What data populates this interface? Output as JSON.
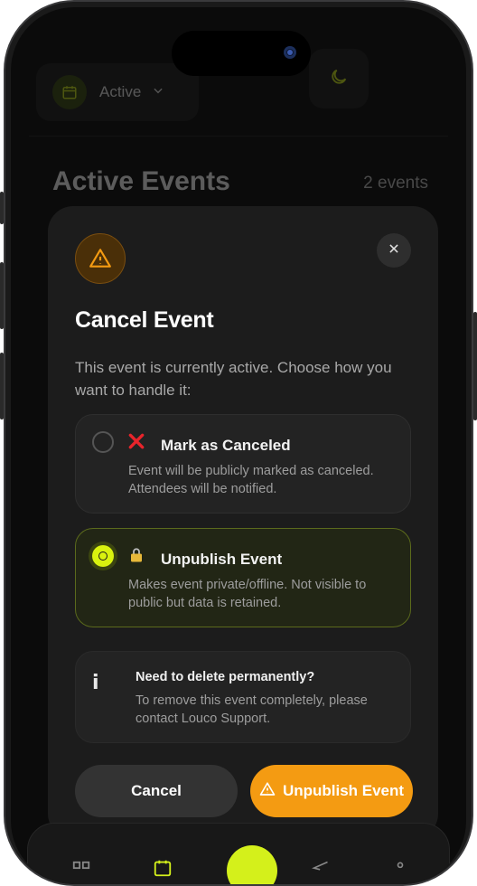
{
  "status_filter": {
    "label": "Active",
    "icon": "calendar-icon"
  },
  "theme_toggle": {
    "icon": "moon-icon"
  },
  "page": {
    "title": "Active Events",
    "count": "2 events"
  },
  "modal": {
    "icon": "warning-icon",
    "title": "Cancel Event",
    "description": "This event is currently active. Choose how you want to handle it:",
    "options": [
      {
        "title": "Mark as Canceled",
        "description": "Event will be publicly marked as canceled. Attendees will be notified.",
        "icon": "red-x-icon",
        "selected": false
      },
      {
        "title": "Unpublish Event",
        "description": "Makes event private/offline. Not visible to public but data is retained.",
        "icon": "lock-icon",
        "selected": true
      }
    ],
    "info": {
      "icon_text": "i",
      "title": "Need to delete permanently?",
      "description": "To remove this event completely, please contact Louco Support."
    },
    "buttons": {
      "cancel": "Cancel",
      "confirm": "Unpublish Event"
    }
  },
  "colors": {
    "accent": "#d9f20f",
    "warning": "#f49b12",
    "danger": "#e8242b"
  }
}
